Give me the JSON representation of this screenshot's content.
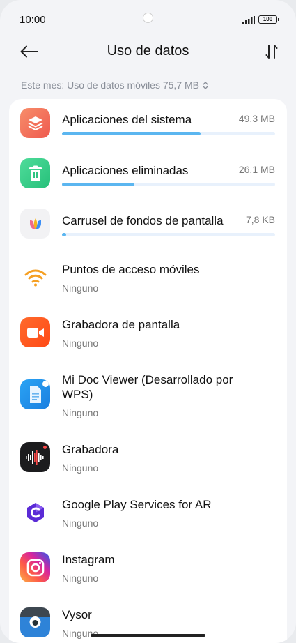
{
  "status_bar": {
    "time": "10:00",
    "battery_level": "100"
  },
  "header": {
    "title": "Uso de datos",
    "back_icon": "arrow-left-icon",
    "sort_icon": "sort-arrows-icon"
  },
  "summary": {
    "label": "Este mes: Uso de datos móviles 75,7 MB",
    "icon": "chevron-up-down-icon"
  },
  "apps": [
    {
      "name": "Aplicaciones del sistema",
      "size": "49,3 MB",
      "usage_fraction": 0.65,
      "icon": "system-apps-icon",
      "color": "#f2705a"
    },
    {
      "name": "Aplicaciones eliminadas",
      "size": "26,1 MB",
      "usage_fraction": 0.34,
      "icon": "trash-icon",
      "color": "#3ad08b"
    },
    {
      "name": "Carrusel de fondos de pantalla",
      "size": "7,8 KB",
      "usage_fraction": 0.02,
      "icon": "wallpaper-carousel-icon",
      "color": "#f2f2f4"
    },
    {
      "name": "Puntos de acceso móviles",
      "subtitle": "Ninguno",
      "icon": "hotspot-icon",
      "color": "#ffffff"
    },
    {
      "name": "Grabadora de pantalla",
      "subtitle": "Ninguno",
      "icon": "screen-recorder-icon",
      "color": "#ff5a1f"
    },
    {
      "name": "Mi Doc Viewer (Desarrollado por WPS)",
      "subtitle": "Ninguno",
      "icon": "doc-viewer-icon",
      "color": "#2196f3"
    },
    {
      "name": "Grabadora",
      "subtitle": "Ninguno",
      "icon": "voice-recorder-icon",
      "color": "#1c1c1e"
    },
    {
      "name": "Google Play Services for AR",
      "subtitle": "Ninguno",
      "icon": "google-ar-icon",
      "color": "#ffffff"
    },
    {
      "name": "Instagram",
      "subtitle": "Ninguno",
      "icon": "instagram-icon",
      "color": "#e1306c"
    },
    {
      "name": "Vysor",
      "subtitle": "Ninguno",
      "icon": "vysor-icon",
      "color": "#e6e6e6"
    }
  ]
}
